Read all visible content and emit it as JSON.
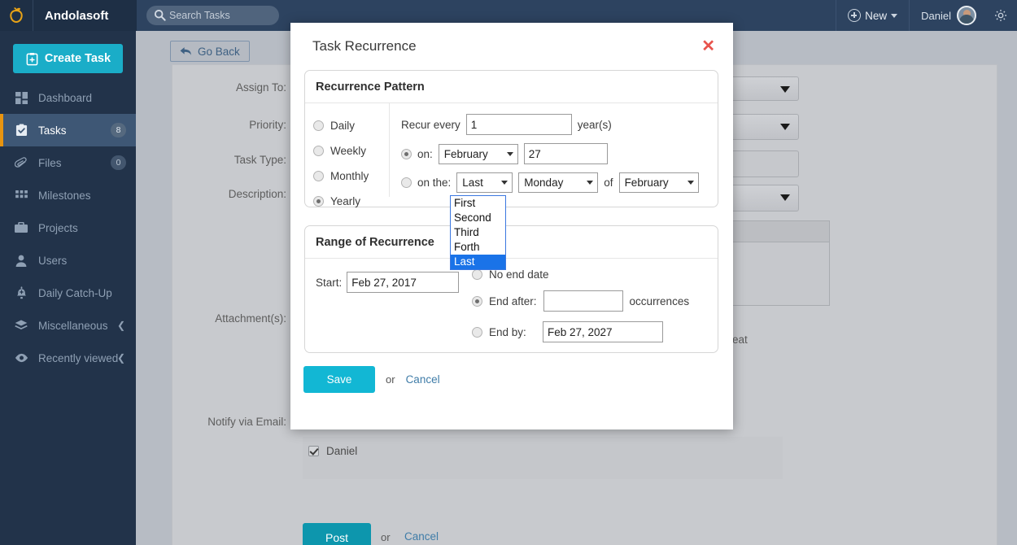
{
  "header": {
    "brand": "Andolasoft",
    "logo_icon": "apple-logo-icon",
    "search": {
      "placeholder": "Search Tasks",
      "value": "",
      "icon": "search-icon"
    },
    "new_button": {
      "label": "New",
      "icon": "plus-circle-icon",
      "caret": "chevron-down-icon"
    },
    "user": {
      "name": "Daniel",
      "avatar": "user-avatar"
    },
    "settings_icon": "gear-icon"
  },
  "sidebar": {
    "create_task": {
      "label": "Create Task",
      "icon": "clipboard-plus-icon"
    },
    "items": [
      {
        "label": "Dashboard",
        "icon": "grid-icon",
        "badge": "",
        "chevron": "",
        "active": false
      },
      {
        "label": "Tasks",
        "icon": "clipboard-check-icon",
        "badge": "8",
        "chevron": "",
        "active": true
      },
      {
        "label": "Files",
        "icon": "paperclip-icon",
        "badge": "0",
        "chevron": "",
        "active": false
      },
      {
        "label": "Milestones",
        "icon": "squares-icon",
        "badge": "",
        "chevron": "",
        "active": false
      },
      {
        "label": "Projects",
        "icon": "briefcase-icon",
        "badge": "",
        "chevron": "",
        "active": false
      },
      {
        "label": "Users",
        "icon": "user-icon",
        "badge": "",
        "chevron": "",
        "active": false
      },
      {
        "label": "Daily Catch-Up",
        "icon": "bell-plus-icon",
        "badge": "",
        "chevron": "",
        "active": false
      },
      {
        "label": "Miscellaneous",
        "icon": "layers-icon",
        "badge": "",
        "chevron": "❮",
        "active": false
      },
      {
        "label": "Recently viewed",
        "icon": "eye-icon",
        "badge": "",
        "chevron": "❮",
        "active": false
      }
    ]
  },
  "main": {
    "go_back": {
      "label": "Go Back",
      "icon": "back-arrow-icon"
    },
    "labels": {
      "assign_to": "Assign To:",
      "priority": "Priority:",
      "task_type": "Task Type:",
      "description": "Description:",
      "attachments": "Attachment(s):",
      "notify_via_email": "Notify via Email:",
      "repeat_partial": "eat"
    },
    "notify_checkbox": {
      "label": "Daniel",
      "checked": true
    },
    "post_button": "Post",
    "or_text": "or",
    "cancel_link": "Cancel"
  },
  "modal": {
    "title": "Task Recurrence",
    "close_icon": "close-icon",
    "pattern": {
      "legend": "Recurrence Pattern",
      "frequency_options": [
        {
          "label": "Daily",
          "selected": false
        },
        {
          "label": "Weekly",
          "selected": false
        },
        {
          "label": "Monthly",
          "selected": false
        },
        {
          "label": "Yearly",
          "selected": true
        }
      ],
      "recur_every_label": "Recur every",
      "recur_every_value": "1",
      "recur_every_unit": "year(s)",
      "on_label": "on:",
      "on_selected": true,
      "on_month": "February",
      "on_day": "27",
      "onthe_label": "on the:",
      "onthe_selected": false,
      "onthe_ordinal": "Last",
      "onthe_weekday": "Monday",
      "onthe_of_label": "of",
      "onthe_month": "February",
      "ordinal_dropdown_open": true,
      "ordinal_options": [
        "First",
        "Second",
        "Third",
        "Forth",
        "Last"
      ],
      "ordinal_highlighted": "Last"
    },
    "range": {
      "legend": "Range of Recurrence",
      "start_label": "Start:",
      "start_value": "Feb 27, 2017",
      "no_end_date": {
        "label": "No end date",
        "selected": false
      },
      "end_after": {
        "label": "End after:",
        "value": "",
        "suffix": "occurrences",
        "selected": true
      },
      "end_by": {
        "label": "End by:",
        "value": "Feb 27, 2027",
        "selected": false
      }
    },
    "actions": {
      "save": "Save",
      "or": "or",
      "cancel": "Cancel"
    }
  },
  "colors": {
    "brand_teal": "#1aadc8",
    "sidebar_bg": "#22334a",
    "header_bg": "#2d4360",
    "active_accent": "#e8940f",
    "close_red": "#e8534c",
    "dropdown_highlight": "#1a73e8"
  }
}
